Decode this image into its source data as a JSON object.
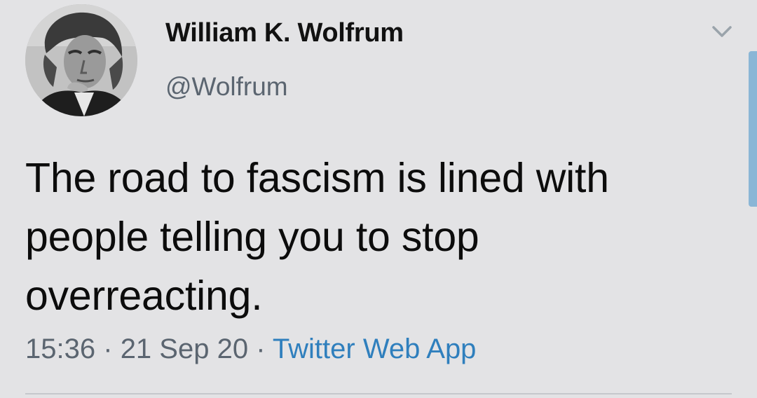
{
  "tweet": {
    "author": {
      "display_name": "William K. Wolfrum",
      "handle": "@Wolfrum",
      "avatar_icon": "profile-photo"
    },
    "text": "The road to fascism is lined with people telling you to stop overreacting.",
    "meta": {
      "time": "15:36",
      "separator": "·",
      "date": "21 Sep 20",
      "source": "Twitter Web App"
    },
    "menu_icon": "chevron-down-icon"
  },
  "colors": {
    "background": "#e3e3e5",
    "text": "#0c0c0c",
    "muted": "#5b6570",
    "link": "#2f7fbd",
    "scrollbar": "#8ab6d6"
  }
}
